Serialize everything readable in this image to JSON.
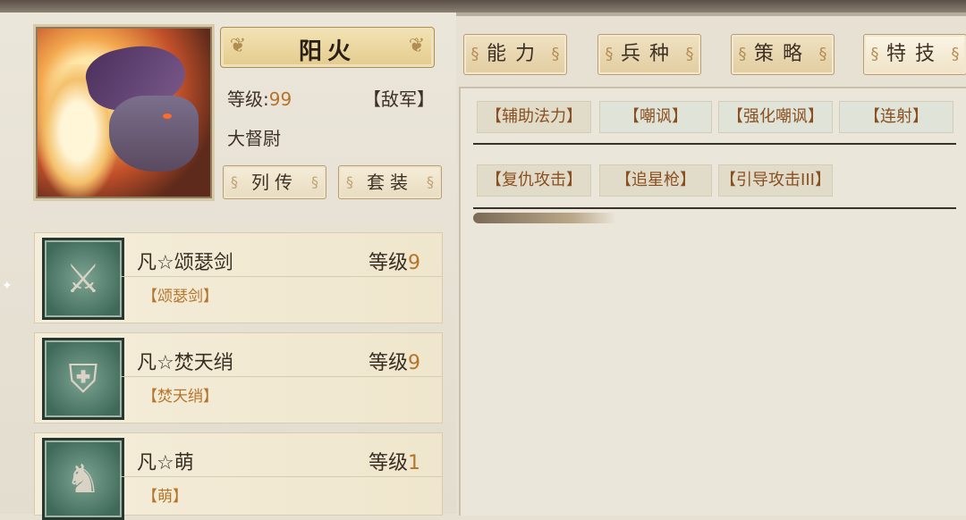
{
  "hero": {
    "name": "阳火",
    "level_label": "等级:",
    "level_value": "99",
    "faction": "【敌军】",
    "rank": "大督尉"
  },
  "hero_buttons": {
    "biography": "列传",
    "outfit": "套装"
  },
  "tabs": [
    {
      "label": "能力",
      "active": false
    },
    {
      "label": "兵种",
      "active": false
    },
    {
      "label": "策略",
      "active": false
    },
    {
      "label": "特技",
      "active": true
    }
  ],
  "skills_row1": [
    "【辅助法力】",
    "【嘲讽】",
    "【强化嘲讽】",
    "【连射】"
  ],
  "skills_row2": [
    "【复仇攻击】",
    "【追星枪】",
    "【引导攻击III】"
  ],
  "equipment": [
    {
      "name": "凡☆颂瑟剑",
      "level_label": "等级",
      "level": "9",
      "sub": "【颂瑟剑】",
      "icon": "sword-icon"
    },
    {
      "name": "凡☆焚天绡",
      "level_label": "等级",
      "level": "9",
      "sub": "【焚天绡】",
      "icon": "armor-icon"
    },
    {
      "name": "凡☆萌",
      "level_label": "等级",
      "level": "1",
      "sub": "【萌】",
      "icon": "horse-icon"
    }
  ],
  "colors": {
    "accent": "#b4742a",
    "skill_text": "#8a4f1f",
    "panel": "#ebe6da"
  }
}
